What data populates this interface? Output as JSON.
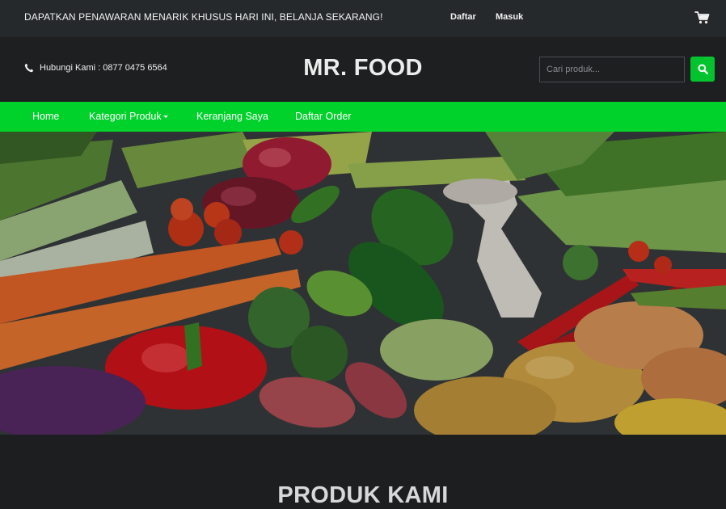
{
  "topbar": {
    "promo_text": "DAPATKAN PENAWARAN MENARIK KHUSUS HARI INI, BELANJA SEKARANG!",
    "register_label": "Daftar",
    "login_label": "Masuk",
    "cart_icon": "cart-icon"
  },
  "header": {
    "contact_text": "Hubungi Kami : 0877 0475 6564",
    "phone_icon": "phone-icon",
    "brand": "MR. FOOD",
    "search_placeholder": "Cari produk...",
    "search_icon": "search-icon"
  },
  "nav": {
    "items": [
      {
        "label": "Home"
      },
      {
        "label": "Kategori Produk",
        "dropdown": true
      },
      {
        "label": "Keranjang Saya"
      },
      {
        "label": "Daftar Order"
      }
    ]
  },
  "hero": {
    "image": "fresh-vegetables-banner"
  },
  "section": {
    "title": "PRODUK KAMI"
  },
  "colors": {
    "accent": "#00d12b",
    "topbar_bg": "#25292b",
    "header_bg": "#1d1f21",
    "page_bg": "#1c1e20"
  }
}
